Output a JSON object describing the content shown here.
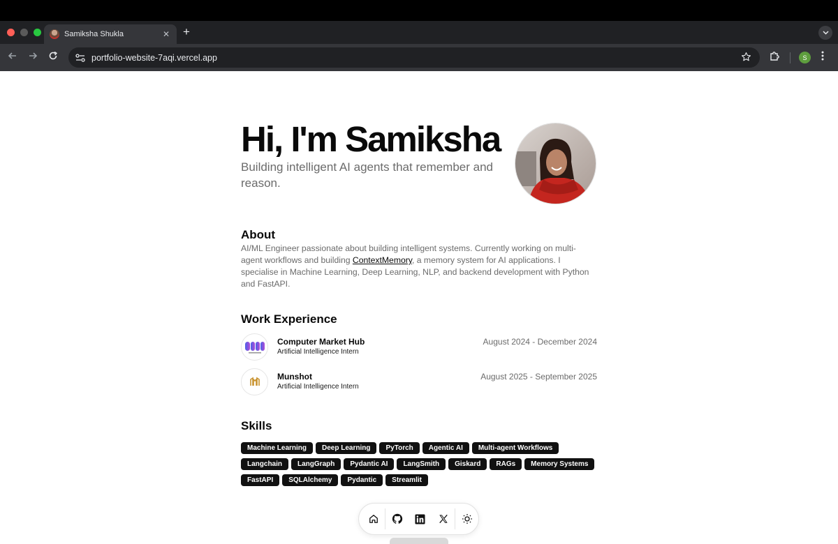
{
  "browser": {
    "tab_title": "Samiksha Shukla",
    "tab_close": "✕",
    "new_tab": "+",
    "url": "portfolio-website-7aqi.vercel.app",
    "profile_initial": "S"
  },
  "hero": {
    "title": "Hi, I'm Samiksha",
    "subtitle": "Building intelligent AI agents that remember and reason."
  },
  "about": {
    "heading": "About",
    "text_before": "AI/ML Engineer passionate about building intelligent systems. Currently working on multi-agent workflows and building ",
    "link": "ContextMemory",
    "text_after": ", a memory system for AI applications. I specialise in Machine Learning, Deep Learning, NLP, and backend development with Python and FastAPI."
  },
  "work": {
    "heading": "Work Experience",
    "jobs": [
      {
        "company": "Computer Market Hub",
        "role": "Artificial Intelligence Intern",
        "start": "August 2024",
        "end": "December 2024"
      },
      {
        "company": "Munshot",
        "role": "Artificial Intelligence Intern",
        "start": "August 2025",
        "end": "September 2025"
      }
    ]
  },
  "skills": {
    "heading": "Skills",
    "items": [
      "Machine Learning",
      "Deep Learning",
      "PyTorch",
      "Agentic AI",
      "Multi-agent Workflows",
      "Langchain",
      "LangGraph",
      "Pydantic AI",
      "LangSmith",
      "Giskard",
      "RAGs",
      "Memory Systems",
      "FastAPI",
      "SQLAlchemy",
      "Pydantic",
      "Streamlit"
    ]
  },
  "dock": {
    "icons": [
      "home-icon",
      "github-icon",
      "linkedin-icon",
      "x-icon",
      "sun-icon"
    ]
  },
  "colors": {
    "browser_frame": "#202124",
    "browser_toolbar": "#35363a",
    "chip_bg": "#111111",
    "text_primary": "#0a0a0a",
    "text_muted": "#6b6b6b"
  }
}
